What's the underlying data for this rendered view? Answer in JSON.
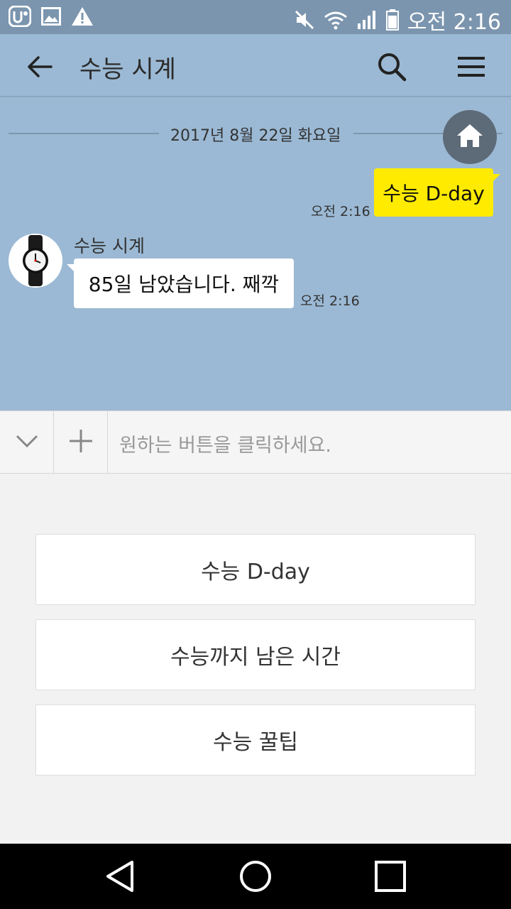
{
  "status_bar": {
    "time": "오전 2:16",
    "icons": [
      "uplus-icon",
      "gallery-icon",
      "warning-icon",
      "mute-icon",
      "wifi-icon",
      "signal-icon",
      "battery-icon"
    ]
  },
  "header": {
    "title": "수능 시계"
  },
  "chat": {
    "date": "2017년 8월 22일 화요일",
    "messages": [
      {
        "from": "me",
        "text": "수능 D-day",
        "time": "오전 2:16"
      },
      {
        "from": "bot",
        "sender": "수능 시계",
        "text": "85일 남았습니다. 째깍",
        "time": "오전 2:16"
      }
    ]
  },
  "input": {
    "placeholder": "원하는 버튼을 클릭하세요."
  },
  "quick_replies": [
    "수능 D-day",
    "수능까지 남은 시간",
    "수능 꿀팁"
  ],
  "colors": {
    "status_bar": "#7b95ae",
    "chat_background": "#9bb9d4",
    "my_bubble": "#ffeb00",
    "home_button": "#5d6a78"
  }
}
